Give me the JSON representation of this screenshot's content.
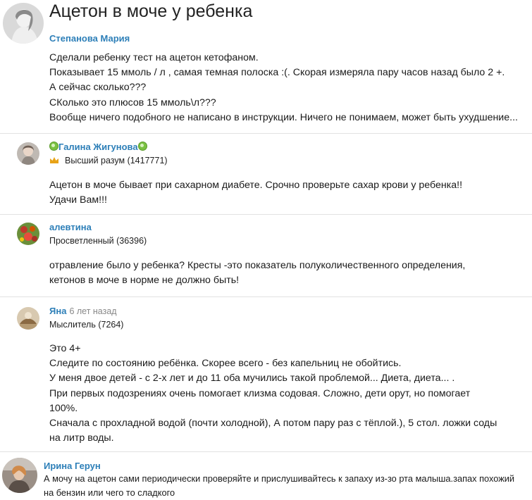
{
  "question": {
    "title": "Ацетон в моче у ребенка",
    "author": "Степанова Мария",
    "lines": [
      "Сделали ребенку тест на ацетон кетофаном.",
      "Показывает 15 ммоль / л , самая темная полоска :(. Скорая измеряла пару часов назад было 2 +.",
      "А сейчас сколько???",
      "СКолько это плюсов 15 ммоль\\л???",
      "Вообще ничего подобного не написано в инструкции. Ничего не понимаем, может быть ухудшение..."
    ]
  },
  "answers": [
    {
      "name": "Галина Жигунова",
      "rank": "Высший разум (1417771)",
      "ago": "",
      "lines": [
        "Ацетон в моче бывает при сахарном диабете. Срочно проверьте сахар крови у ребенка!!",
        "Удачи Вам!!!"
      ]
    },
    {
      "name": "алевтина",
      "rank": "Просветленный (36396)",
      "ago": "",
      "lines": [
        "отравление было у ребенка? Кресты -это показатель полуколичественного определения,",
        "кетонов в моче в норме не должно быть!"
      ]
    },
    {
      "name": "Яна",
      "rank": "Мыслитель (7264)",
      "ago": "6 лет назад",
      "lines": [
        "Это 4+",
        "Следите по состоянию ребёнка. Скорее всего - без капельниц не обойтись.",
        "У меня двое детей - с 2-х лет и до 11 оба мучились такой проблемой... Диета, диета... .",
        "При первых подозрениях очень помогает клизма содовая. Сложно, дети орут, но помогает",
        "100%.",
        "Сначала с прохладной водой (почти холодной), А потом пару раз с тёплой.), 5 стол. ложки соды",
        "на литр воды."
      ]
    },
    {
      "name": "Ирина Герун",
      "rank": "",
      "ago": "",
      "lines": [
        "А мочу на ацетон сами периодически проверяйте и прислушивайтесь к запаху из-зо рта малыша.запах похожий",
        "на бензин или чего то сладкого"
      ]
    }
  ],
  "colors": {
    "username": "#2d7fb8",
    "rank_crown": "#e8a317",
    "online_badge": "#7ac142"
  },
  "icons": {
    "crown": "crown-icon",
    "badge": "online-badge-icon"
  }
}
